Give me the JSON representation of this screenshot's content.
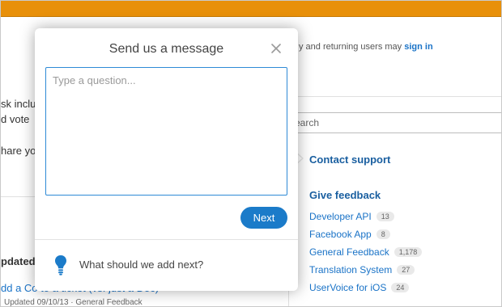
{
  "header": {
    "accent_color": "#e8900a"
  },
  "background_page": {
    "signin_text": "y and returning users may",
    "signin_link": "sign in",
    "left_snippets": [
      "sk inclu",
      "d vote",
      "hare yo"
    ],
    "search_placeholder": "earch",
    "updated_heading": "pdated",
    "recent_link": "dd a Co to a ticket (vs. just a Doc)",
    "recent_meta": "Updated 09/10/13 · General Feedback"
  },
  "sidebar": {
    "contact_label": "Contact support",
    "feedback_heading": "Give feedback",
    "forums": [
      {
        "label": "Developer API",
        "count": "13"
      },
      {
        "label": "Facebook App",
        "count": "8"
      },
      {
        "label": "General Feedback",
        "count": "1,178"
      },
      {
        "label": "Translation System",
        "count": "27"
      },
      {
        "label": "UserVoice for iOS",
        "count": "24"
      }
    ]
  },
  "modal": {
    "title": "Send us a message",
    "close_icon": "close-icon",
    "question_placeholder": "Type a question...",
    "question_value": "",
    "next_label": "Next",
    "bulb_icon": "lightbulb-icon",
    "prompt_label": "What should we add next?",
    "accent_color": "#1b7bc9"
  }
}
